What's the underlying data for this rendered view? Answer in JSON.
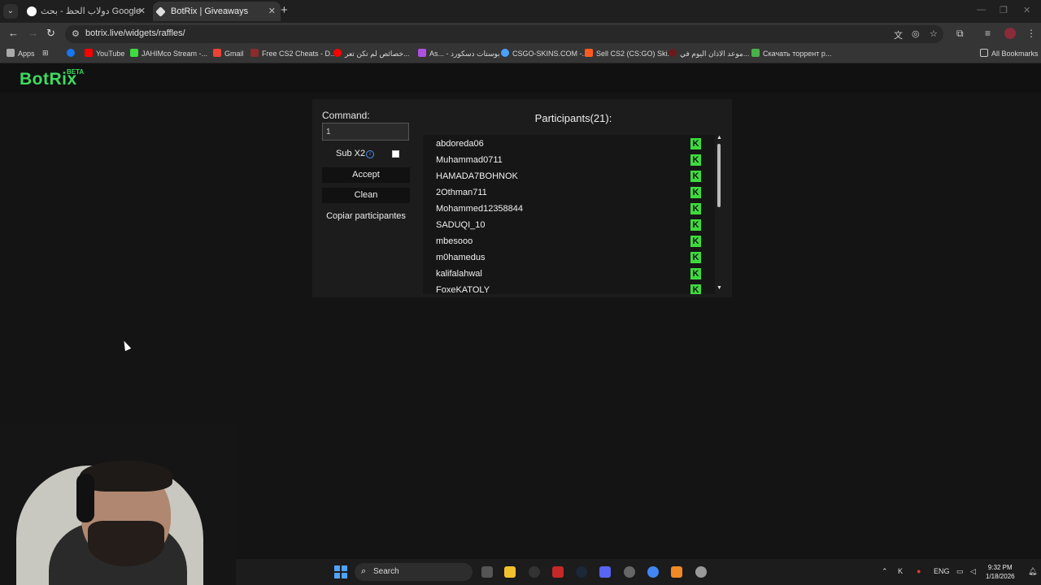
{
  "browser": {
    "tabs": [
      {
        "title": "دولاب الحظ - بحث Google"
      },
      {
        "title": "BotRix | Giveaways"
      }
    ],
    "url": "botrix.live/widgets/raffles/",
    "bookmarks": [
      {
        "label": "Apps",
        "icon": "apps-grid-icon"
      },
      {
        "label": "YouTube",
        "color": "#1877f2"
      },
      {
        "label": "JAHIMco Stream -...",
        "color": "#3ddb3d"
      },
      {
        "label": "Gmail",
        "color": "#ea4335"
      },
      {
        "label": "Free CS2 Cheats - D...",
        "color": "#8b2b2b"
      },
      {
        "label": "خصائص لم تكن تعر...",
        "color": "#ff0000"
      },
      {
        "label": "As... - بوستات دسكورد",
        "color": "#b050e0"
      },
      {
        "label": "CSGO-SKINS.COM -...",
        "color": "#4aa0ff"
      },
      {
        "label": "Sell CS2 (CS:GO) Ski...",
        "color": "#ff5a1f"
      },
      {
        "label": "موعد الاذان اليوم في...",
        "color": "#6a1a1a"
      },
      {
        "label": "Скачать торрент р...",
        "color": "#49b04a"
      }
    ],
    "all_bookmarks": "All Bookmarks"
  },
  "site": {
    "logo": "BotRix",
    "logo_badge": "BETA"
  },
  "raffle": {
    "command_label": "Command:",
    "command_value": "1",
    "sub_x2_label": "Sub X2",
    "sub_x2_checked": false,
    "accept_label": "Accept",
    "clean_label": "Clean",
    "copy_label": "Copiar participantes",
    "participants_title": "Participants(21):",
    "participants": [
      "abdoreda06",
      "Muhammad0711",
      "HAMADA7BOHNOK",
      "2Othman711",
      "Mohammed12358844",
      "SADUQI_10",
      "mbesooo",
      "m0hamedus",
      "kalifalahwal",
      "FoxeKATOLY"
    ],
    "platform_icon": "kick-icon",
    "platform_color": "#3ddb3d"
  },
  "taskbar": {
    "search_label": "Search",
    "lang": "ENG",
    "time": "9:32 PM",
    "date": "1/18/2026"
  }
}
